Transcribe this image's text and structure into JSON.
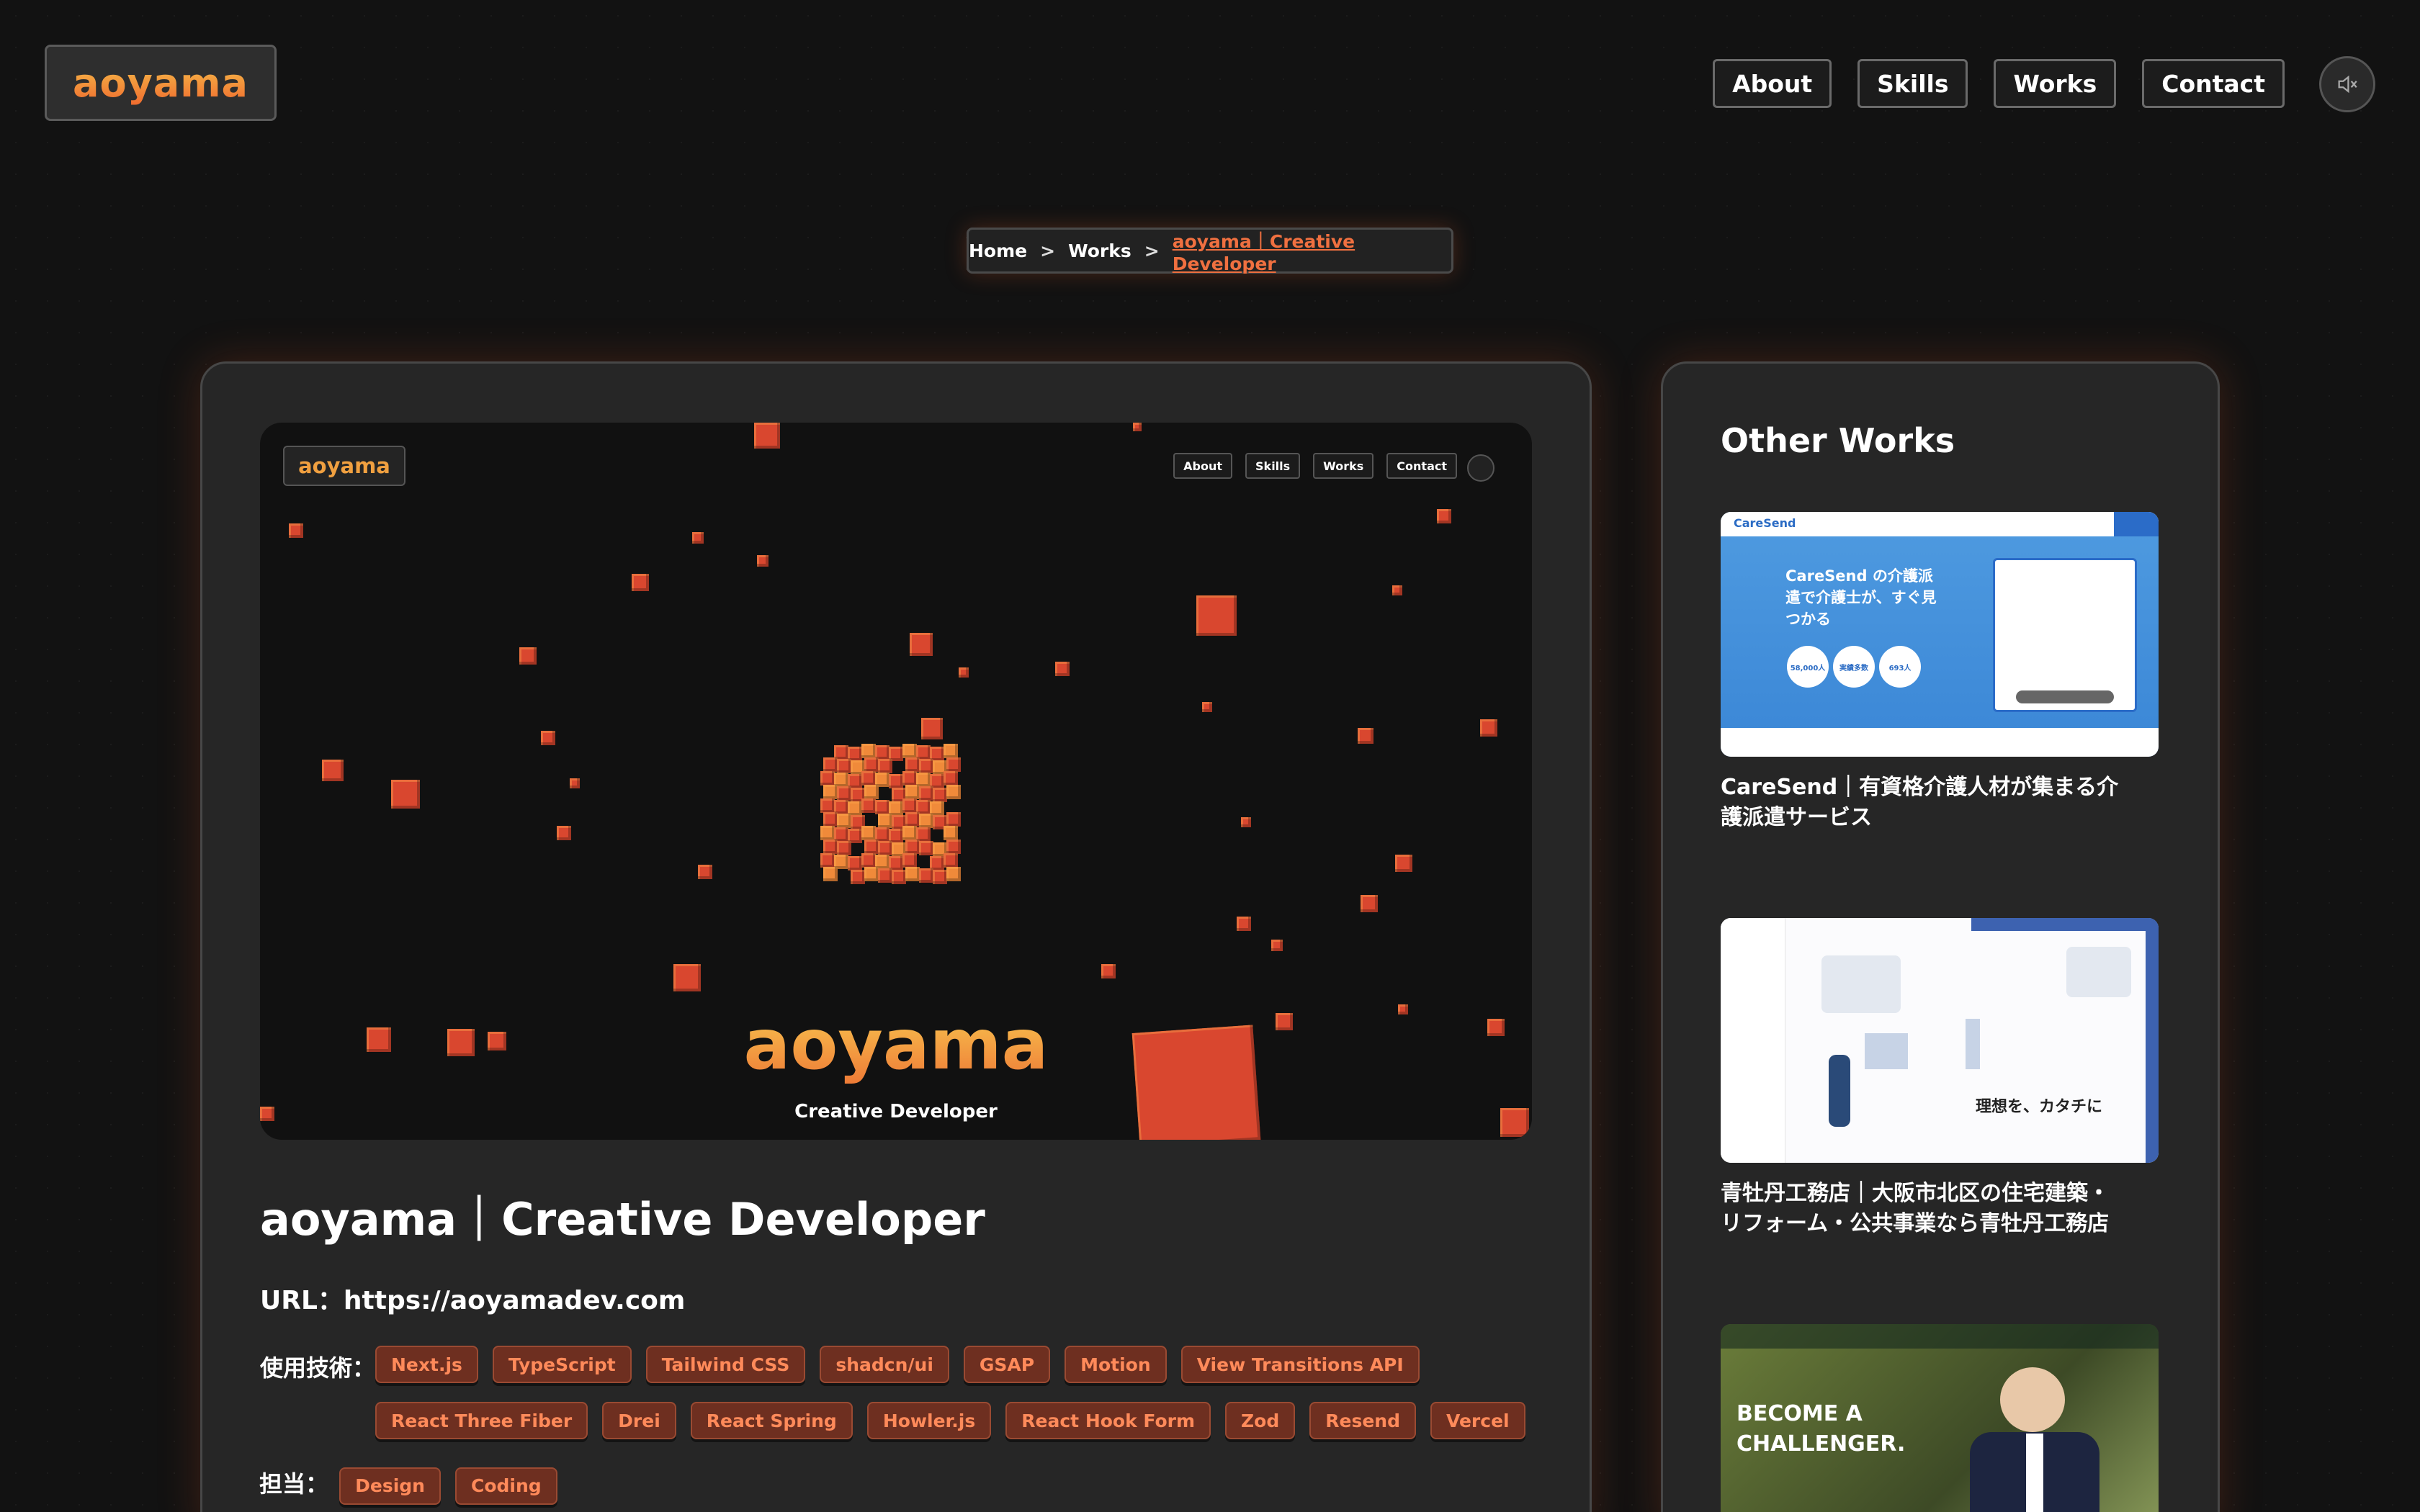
{
  "header": {
    "logo": "aoyama",
    "nav": [
      "About",
      "Skills",
      "Works",
      "Contact"
    ]
  },
  "breadcrumb": {
    "home": "Home",
    "sep": ">",
    "works": "Works",
    "current": "aoyama｜Creative Developer"
  },
  "preview": {
    "logo": "aoyama",
    "nav": [
      "About",
      "Skills",
      "Works",
      "Contact"
    ],
    "title": "aoyama",
    "subtitle": "Creative Developer"
  },
  "work": {
    "title": "aoyama｜Creative Developer",
    "url_label": "URL：",
    "url": "https://aoyamadev.com",
    "tech_label": "使用技術：",
    "tech": [
      "Next.js",
      "TypeScript",
      "Tailwind CSS",
      "shadcn/ui",
      "GSAP",
      "Motion",
      "View Transitions API",
      "React Three Fiber",
      "Drei",
      "React Spring",
      "Howler.js",
      "React Hook Form",
      "Zod",
      "Resend",
      "Vercel"
    ],
    "role_label": "担当：",
    "roles": [
      "Design",
      "Coding"
    ]
  },
  "other_works": {
    "title": "Other Works",
    "items": [
      {
        "label": "CareSend｜有資格介護人材が集まる介護派遣サービス",
        "thumb": {
          "brand": "CareSend",
          "headline": "CareSend の介護派遣で介護士が、すぐ見つかる",
          "stat1": "58,000人",
          "stat2": "実績多数",
          "stat3": "693人"
        }
      },
      {
        "label": "青牡丹工務店｜大阪市北区の住宅建築・リフォーム・公共事業なら青牡丹工務店",
        "thumb": {
          "headline": "理想を、カタチに"
        }
      },
      {
        "label": "",
        "thumb": {
          "headline": "BECOME A CHALLENGER."
        }
      }
    ]
  },
  "colors": {
    "accent": "#f07040",
    "tag_bg": "#6e2f20",
    "panel_bg": "#262626",
    "page_bg": "#121212"
  }
}
